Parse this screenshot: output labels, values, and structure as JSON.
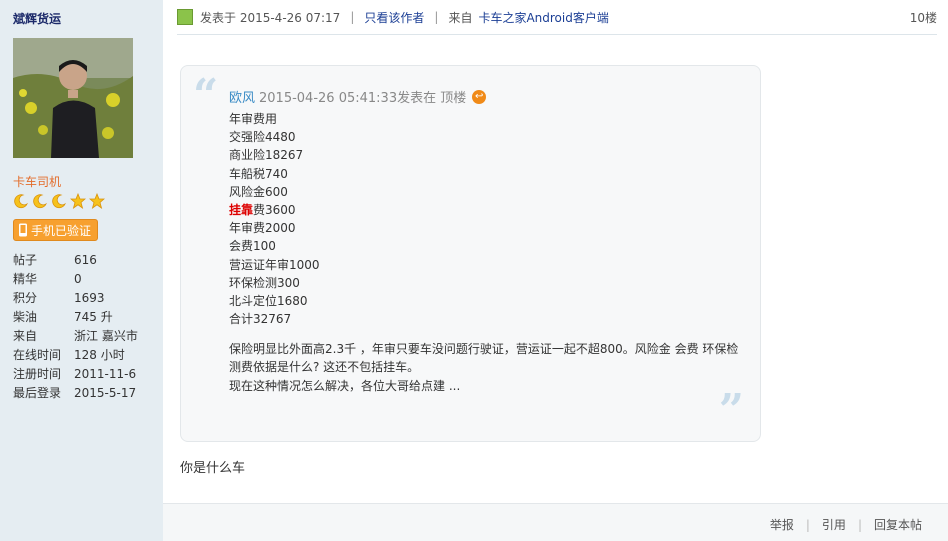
{
  "user": {
    "name": "斌辉货运",
    "role": "卡车司机",
    "verify_label": "手机已验证",
    "stats": [
      {
        "label": "帖子",
        "value": "616"
      },
      {
        "label": "精华",
        "value": "0"
      },
      {
        "label": "积分",
        "value": "1693"
      },
      {
        "label": "柴油",
        "value": "745 升"
      },
      {
        "label": "来自",
        "value": "浙江 嘉兴市"
      },
      {
        "label": "在线时间",
        "value": "128 小时"
      },
      {
        "label": "注册时间",
        "value": "2011-11-6"
      },
      {
        "label": "最后登录",
        "value": "2015-5-17"
      }
    ]
  },
  "post": {
    "posted_label": "发表于 2015-4-26 07:17",
    "author_only_label": "只看该作者",
    "from_prefix": "来自",
    "from_link": "卡车之家Android客户端",
    "floor": "10楼",
    "reply_text": "你是什么车"
  },
  "quote": {
    "author": "欧风",
    "meta": "2015-04-26 05:41:33发表在 顶楼",
    "jump_icon": "arrow-return-icon",
    "lines_before": [
      "年审费用",
      "交强险4480",
      "商业险18267",
      "车船税740",
      "风险金600"
    ],
    "highlight_word": "挂靠",
    "highlight_rest": "费3600",
    "lines_after": [
      "年审费2000",
      "会费100",
      "营运证年审1000",
      "环保检测300",
      "北斗定位1680",
      "合计32767"
    ],
    "para": [
      "保险明显比外面高2.3千 ，年审只要车没问题行驶证，营运证一起不超800。风险金 会费 环保检",
      "测费依据是什么? 这还不包括挂车。",
      "现在这种情况怎么解决，各位大哥给点建 ..."
    ]
  },
  "actions": {
    "report": "举报",
    "quote": "引用",
    "reply": "回复本帖"
  },
  "colors": {
    "sidebar_bg": "#e5edf2",
    "link": "#1c3f95",
    "role": "#e36d2c",
    "verify_bg": "#f7a02f",
    "highlight": "#dd0000"
  }
}
